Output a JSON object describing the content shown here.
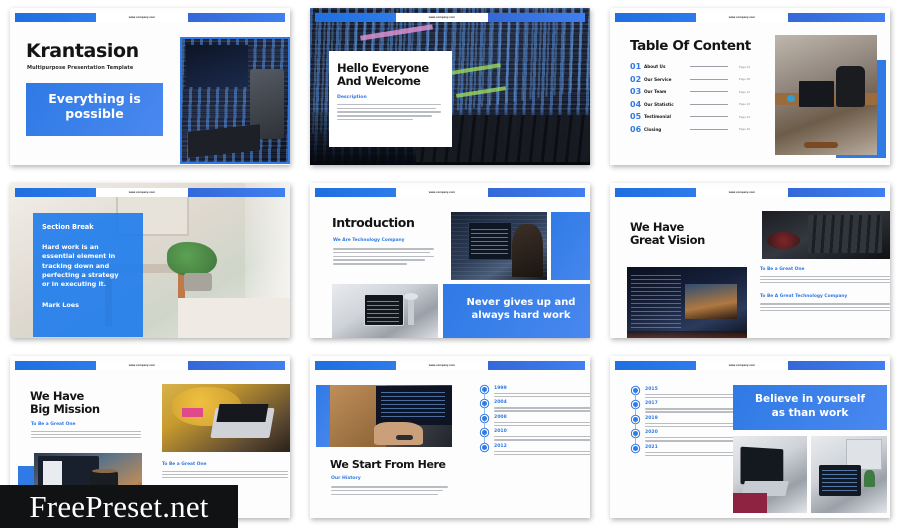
{
  "meta": {
    "brand_blue": "#2f7ae5",
    "dark_text": "#141414",
    "watermark": "FreePreset.net",
    "site_label": "www.company.com"
  },
  "slides": [
    {
      "id": "title-slide",
      "title": "Krantasion",
      "subtitle": "Multipurpose Presentation Template",
      "callout": "Everything is\npossible",
      "callout_line1": "Everything is",
      "callout_line2": "possible"
    },
    {
      "id": "hello-slide",
      "title_line1": "Hello Everyone",
      "title_line2": "And Welcome",
      "section_label": "Description",
      "body": "Lorem ipsum dolor sit amet, consectetur adipiscing elit, sed diam nonummy nibh euismod tincidunt ut laoreet dolore magna aliquam erat volutpat. Ut wisi enim ad minim veniam, quis nostrud exerci tation ullamcorper suscipit lobortis nisl ut aliquip ex ea commodo."
    },
    {
      "id": "toc-slide",
      "title": "Table Of Content",
      "items": [
        {
          "num": "01",
          "label": "About Us",
          "page": "Page 03"
        },
        {
          "num": "02",
          "label": "Our Service",
          "page": "Page 08"
        },
        {
          "num": "03",
          "label": "Our Team",
          "page": "Page 12"
        },
        {
          "num": "04",
          "label": "Our Statistic",
          "page": "Page 16"
        },
        {
          "num": "05",
          "label": "Testimonial",
          "page": "Page 24"
        },
        {
          "num": "06",
          "label": "Closing",
          "page": "Page 30"
        }
      ]
    },
    {
      "id": "section-break-slide",
      "label": "Section Break",
      "quote": "Hard work is an essential element in tracking down and perfecting a strategy or in executing it.",
      "quote_lines": [
        "Hard work is an",
        "essential element in",
        "tracking down and",
        "perfecting a strategy",
        "or in executing it."
      ],
      "author": "Mark Loes"
    },
    {
      "id": "introduction-slide",
      "title": "Introduction",
      "section_label": "We Are Technology Company",
      "body": "Lorem ipsum dolor sit amet, consectetur adipiscing elit, sed diam nonummy nibh euismod tincidunt ut laoreet dolore magna aliquam erat volutpat. Ut wisi enim ad minim veniam, quis nostrud exerci tation ullamcorper suscipit lobortis nisl ut aliquip ex ea commodo.",
      "callout_line1": "Never gives up and",
      "callout_line2": "always hard work"
    },
    {
      "id": "great-vision-slide",
      "title_line1": "We Have",
      "title_line2": "Great Vision",
      "blocks": [
        {
          "heading": "To Be a Great One",
          "body": "Lorem ipsum dolor sit amet, consectetur adipiscing elit, sed diam nonummy nibh euismod tincidunt ut laoreet dolore magna aliquam erat volutpat. Ut wisi enim ad minim veniam, quis nostrud exerci tation."
        },
        {
          "heading": "To Be A Great Technology  Company",
          "body": "Lorem ipsum dolor sit amet, consectetur adipiscing elit, sed diam nonummy nibh euismod tincidunt ut laoreet dolore magna aliquam erat volutpat. Ut wisi enim ad minim veniam, quis nostrud exerci tation."
        }
      ]
    },
    {
      "id": "big-mission-slide",
      "title_line1": "We Have",
      "title_line2": "Big Mission",
      "blocks": [
        {
          "heading": "To Be a Great One",
          "body": "Lorem ipsum dolor sit amet, consectetur adipiscing elit, sed diam nonummy nibh euismod tincidunt ut laoreet dolore magna aliquam erat volutpat. Ut wisi enim ad minim veniam, quis nostrud exerci tation."
        },
        {
          "heading": "To Be a Great One",
          "body": "Lorem ipsum dolor sit amet, consectetur adipiscing elit, sed diam nonummy nibh euismod tincidunt ut laoreet dolore magna aliquam erat volutpat. Ut wisi enim ad minim veniam, quis nostrud exerci tation."
        }
      ]
    },
    {
      "id": "start-from-here-slide",
      "title": "We Start From Here",
      "section_label": "Our History",
      "body": "Lorem ipsum dolor sit amet, consectetur adipiscing elit, sed diam nonummy nibh euismod tincidunt ut laoreet dolore magna aliquam erat volutpat. Ut wisi enim ad minim veniam, quis nostrud exerci tation ullamcorper suscipit.",
      "timeline": [
        {
          "year": "1999",
          "body": "Proin ac mauris vitae augue auctor euismod ac ut mi. Nam facilisis leo."
        },
        {
          "year": "2004",
          "body": "Proin ac mauris vitae augue auctor euismod ac ut mi. Nam facilisis leo."
        },
        {
          "year": "2008",
          "body": "Proin ac mauris vitae augue auctor euismod ac ut mi. Nam facilisis leo."
        },
        {
          "year": "2010",
          "body": "Proin ac mauris vitae augue auctor euismod ac ut mi. Nam facilisis leo."
        },
        {
          "year": "2012",
          "body": "Proin ac mauris vitae augue auctor euismod ac ut mi. Nam facilisis leo."
        }
      ]
    },
    {
      "id": "believe-slide",
      "callout_line1": "Believe in yourself",
      "callout_line2": "as than work",
      "timeline": [
        {
          "year": "2015",
          "body": "Proin ac mauris vitae augue auctor euismod ac ut mi. Nam facilisis leo."
        },
        {
          "year": "2017",
          "body": "Proin ac mauris vitae augue auctor euismod ac ut mi. Nam facilisis leo."
        },
        {
          "year": "2019",
          "body": "Proin ac mauris vitae augue auctor euismod ac ut mi. Nam facilisis leo."
        },
        {
          "year": "2020",
          "body": "Proin ac mauris vitae augue auctor euismod ac ut mi. Nam facilisis leo."
        },
        {
          "year": "2021",
          "body": "Proin ac mauris vitae augue auctor euismod ac ut mi. Nam facilisis leo."
        }
      ]
    }
  ]
}
